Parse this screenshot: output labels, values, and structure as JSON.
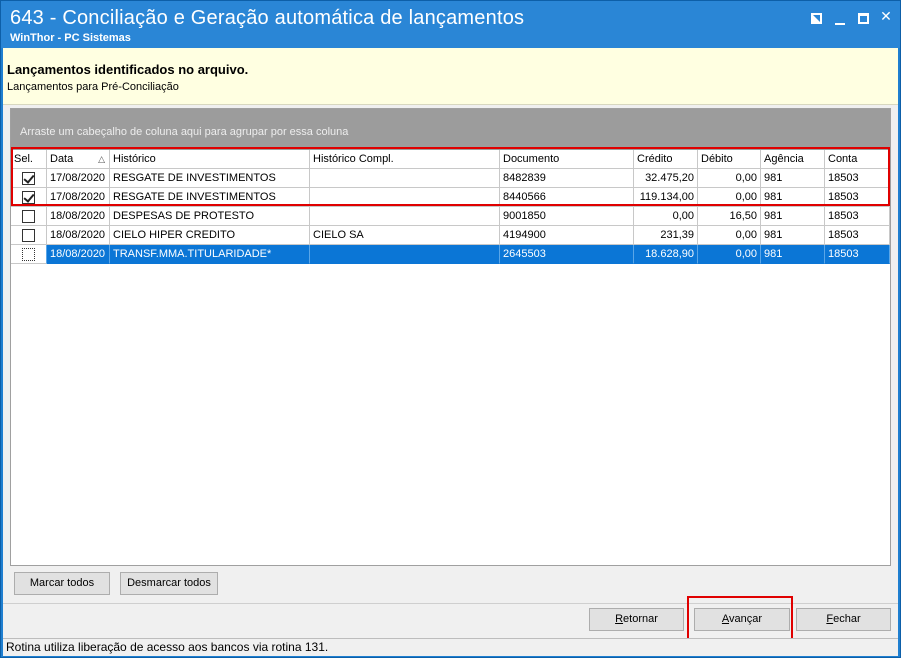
{
  "window": {
    "title": "643 - Conciliação e Geração automática de lançamentos",
    "subtitle": "WinThor - PC Sistemas",
    "controls": [
      "restore-icon",
      "minimize-icon",
      "maximize-icon",
      "close-icon"
    ],
    "close_glyph": "✕"
  },
  "header": {
    "title": "Lançamentos identificados no arquivo.",
    "subtitle": "Lançamentos para Pré-Conciliação"
  },
  "grid": {
    "group_hint": "Arraste um cabeçalho de coluna aqui para agrupar por essa coluna",
    "columns": [
      "Sel.",
      "Data",
      "Histórico",
      "Histórico Compl.",
      "Documento",
      "Crédito",
      "Débito",
      "Agência",
      "Conta"
    ],
    "sort_glyph": "△",
    "rows": [
      {
        "sel": true,
        "data": "17/08/2020",
        "historico": "RESGATE DE INVESTIMENTOS",
        "compl": "",
        "documento": "8482839",
        "credito": "32.475,20",
        "debito": "0,00",
        "agencia": "981",
        "conta": "18503"
      },
      {
        "sel": true,
        "data": "17/08/2020",
        "historico": "RESGATE DE INVESTIMENTOS",
        "compl": "",
        "documento": "8440566",
        "credito": "119.134,00",
        "debito": "0,00",
        "agencia": "981",
        "conta": "18503"
      },
      {
        "sel": false,
        "data": "18/08/2020",
        "historico": "DESPESAS DE PROTESTO",
        "compl": "",
        "documento": "9001850",
        "credito": "0,00",
        "debito": "16,50",
        "agencia": "981",
        "conta": "18503"
      },
      {
        "sel": false,
        "data": "18/08/2020",
        "historico": "CIELO HIPER CREDITO",
        "compl": "CIELO SA",
        "documento": "4194900",
        "credito": "231,39",
        "debito": "0,00",
        "agencia": "981",
        "conta": "18503"
      },
      {
        "sel": false,
        "data": "18/08/2020",
        "historico": "TRANSF.MMA.TITULARIDADE*",
        "compl": "",
        "documento": "2645503",
        "credito": "18.628,90",
        "debito": "0,00",
        "agencia": "981",
        "conta": "18503"
      }
    ],
    "selected_row_color": "#0b76d6"
  },
  "buttons": {
    "marcar": "Marcar todos",
    "desmarcar": "Desmarcar todos",
    "retornar_hot": "R",
    "retornar_rest": "etornar",
    "avancar_hot": "A",
    "avancar_rest": "vançar",
    "fechar_hot": "F",
    "fechar_rest": "echar"
  },
  "status": {
    "text": "Rotina utiliza liberação de acesso aos bancos via rotina 131."
  },
  "colors": {
    "titlebar": "#2a86d6",
    "highlight": "#e00000",
    "info_panel": "#ffffe1"
  }
}
